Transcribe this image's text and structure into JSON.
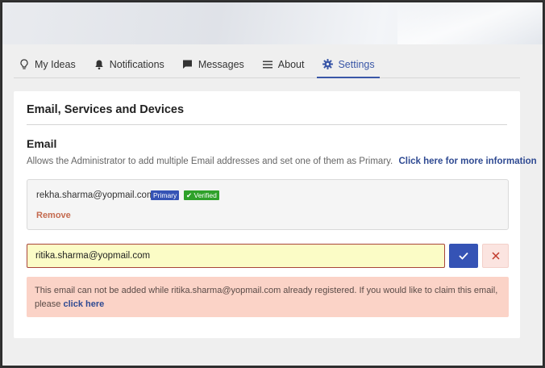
{
  "tabs": [
    {
      "label": "My Ideas",
      "icon": "lightbulb-icon"
    },
    {
      "label": "Notifications",
      "icon": "bell-icon"
    },
    {
      "label": "Messages",
      "icon": "message-icon"
    },
    {
      "label": "About",
      "icon": "list-icon"
    },
    {
      "label": "Settings",
      "icon": "gear-icon",
      "active": true
    }
  ],
  "card": {
    "title": "Email, Services and Devices",
    "section_title": "Email",
    "description": "Allows the Administrator to add multiple Email addresses and set one of them as Primary.",
    "info_link": "Click here for more information"
  },
  "existing_email": {
    "address": "rekha.sharma@yopmail.com",
    "primary_badge": "Primary",
    "verified_badge": "Verified",
    "remove_label": "Remove"
  },
  "new_email": {
    "value": "ritika.sharma@yopmail.com"
  },
  "alert": {
    "message": "This email can not be added while ritika.sharma@yopmail.com already registered. If you would like to claim this email, please",
    "link": "click here"
  },
  "colors": {
    "accent": "#3553b5",
    "verified": "#2fa12a",
    "remove": "#c46a4f",
    "input_bg": "#fbfcc6",
    "alert_bg": "#fbd3c7"
  }
}
